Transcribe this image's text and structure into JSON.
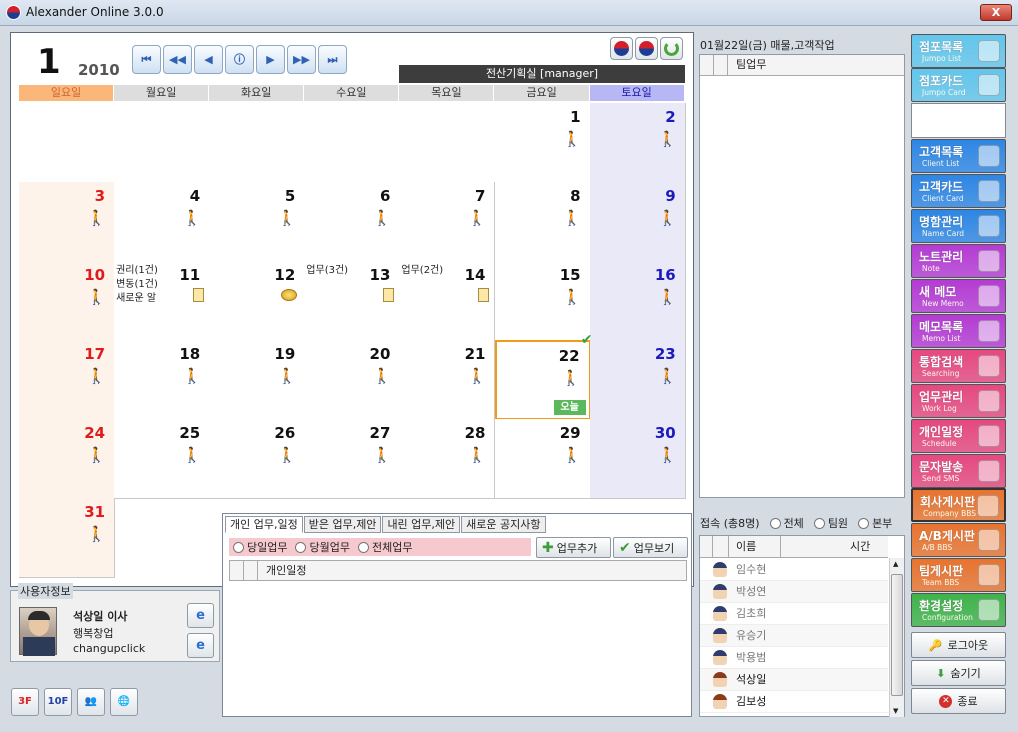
{
  "window": {
    "title": "Alexander Online 3.0.0",
    "close": "X"
  },
  "calendar": {
    "month": "1",
    "year": "2010",
    "department": "전산기획실 [manager]",
    "weekdays": [
      "일요일",
      "월요일",
      "화요일",
      "수요일",
      "목요일",
      "금요일",
      "토요일"
    ],
    "nav": [
      "⏮",
      "◀◀",
      "◀",
      "ⓘ",
      "▶",
      "▶▶",
      "⏭"
    ],
    "today_label": "오늘",
    "events": {
      "d11": [
        "권리(1건)",
        "변동(1건)",
        "새로운 알"
      ],
      "d13": [
        "업무(3건)"
      ],
      "d14": [
        "업무(2건)"
      ]
    }
  },
  "tabs": {
    "items": [
      "개인 업무,일정",
      "받은 업무,제안",
      "내린 업무,제안",
      "새로운 공지사항"
    ],
    "filters": [
      "당일업무",
      "당월업무",
      "전체업무"
    ],
    "add_task": "업무추가",
    "view_task": "업무보기",
    "list_header": "개인일정"
  },
  "user": {
    "legend": "사용자정보",
    "name": "석상일 이사",
    "company": "행복창업",
    "id": "changupclick"
  },
  "bottom_buttons": [
    "3F",
    "10F"
  ],
  "right": {
    "date_header": "01월22일(금) 매물,고객작업",
    "team_header": "팀업무",
    "connected": "접속 (총8명)",
    "conn_filters": [
      "전체",
      "팀원",
      "본부"
    ],
    "conn_headers": {
      "name": "이름",
      "time": "시간"
    },
    "people": [
      {
        "name": "임수현",
        "female": false
      },
      {
        "name": "박성연",
        "female": false
      },
      {
        "name": "김초희",
        "female": false
      },
      {
        "name": "유승기",
        "female": false
      },
      {
        "name": "박용범",
        "female": false
      },
      {
        "name": "석상일",
        "female": true
      },
      {
        "name": "김보성",
        "female": true
      }
    ]
  },
  "sidebar": [
    {
      "ko": "점포목록",
      "en": "Jumpo List",
      "color": "#62c6ec"
    },
    {
      "ko": "점포카드",
      "en": "Jumpo Card",
      "color": "#62c6ec"
    },
    {
      "ko": "고객목록",
      "en": "Client List",
      "color": "#2d86e4"
    },
    {
      "ko": "고객카드",
      "en": "Client Card",
      "color": "#2d86e4"
    },
    {
      "ko": "명함관리",
      "en": "Name Card",
      "color": "#2d86e4"
    },
    {
      "ko": "노트관리",
      "en": "Note",
      "color": "#b53ad4"
    },
    {
      "ko": "새 메모",
      "en": "New Memo",
      "color": "#b53ad4"
    },
    {
      "ko": "메모목록",
      "en": "Memo List",
      "color": "#b53ad4"
    },
    {
      "ko": "통합검색",
      "en": "Searching",
      "color": "#e6487f"
    },
    {
      "ko": "업무관리",
      "en": "Work Log",
      "color": "#e6487f"
    },
    {
      "ko": "개인일정",
      "en": "Schedule",
      "color": "#e6487f"
    },
    {
      "ko": "문자발송",
      "en": "Send SMS",
      "color": "#e6487f"
    },
    {
      "ko": "회사게시판",
      "en": "Company BBS",
      "color": "#e8732e"
    },
    {
      "ko": "A/B게시판",
      "en": "A/B BBS",
      "color": "#e8732e"
    },
    {
      "ko": "팀게시판",
      "en": "Team BBS",
      "color": "#e8732e"
    },
    {
      "ko": "환경설정",
      "en": "Configuration",
      "color": "#3fb34a"
    }
  ],
  "actions": {
    "logout": "로그아웃",
    "hide": "숨기기",
    "exit": "종료"
  }
}
